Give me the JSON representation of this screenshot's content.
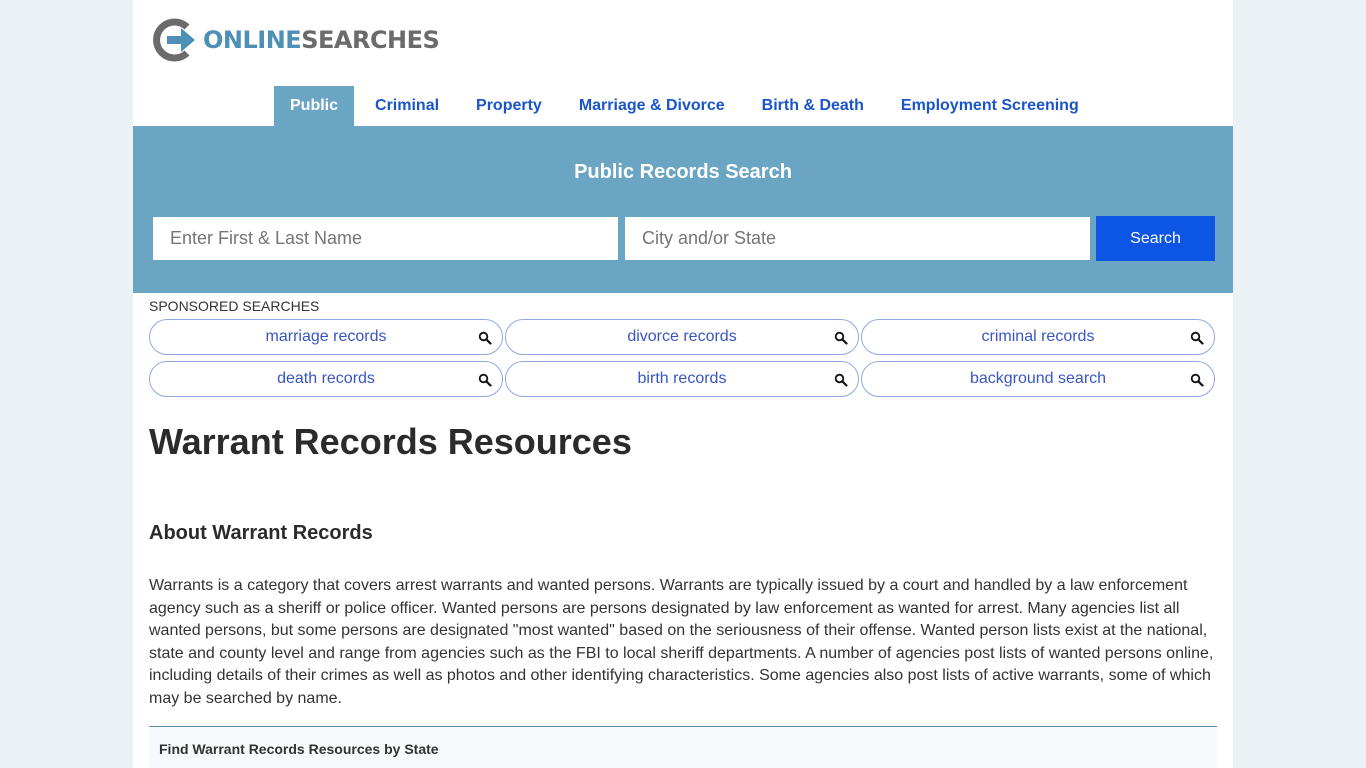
{
  "logo": {
    "part1": "ONLINE",
    "part2": "SEARCHES"
  },
  "nav": {
    "items": [
      {
        "label": "Public",
        "active": true
      },
      {
        "label": "Criminal",
        "active": false
      },
      {
        "label": "Property",
        "active": false
      },
      {
        "label": "Marriage & Divorce",
        "active": false
      },
      {
        "label": "Birth & Death",
        "active": false
      },
      {
        "label": "Employment Screening",
        "active": false
      }
    ]
  },
  "hero": {
    "title": "Public Records Search",
    "name_placeholder": "Enter First & Last Name",
    "name_value": "",
    "location_placeholder": "City and/or State",
    "location_value": "",
    "search_label": "Search"
  },
  "sponsored": {
    "label": "SPONSORED SEARCHES",
    "items": [
      "marriage records",
      "divorce records",
      "criminal records",
      "death records",
      "birth records",
      "background search"
    ]
  },
  "content": {
    "page_title": "Warrant Records Resources",
    "section_title": "About Warrant Records",
    "paragraph": "Warrants is a category that covers arrest warrants and wanted persons. Warrants are typically issued by a court and handled by a law enforcement agency such as a sheriff or police officer. Wanted persons are persons designated by law enforcement as wanted for arrest. Many agencies list all wanted persons, but some persons are designated \"most wanted\" based on the seriousness of their offense. Wanted person lists exist at the national, state and county level and range from agencies such as the FBI to local sheriff departments. A number of agencies post lists of wanted persons online, including details of their crimes as well as photos and other identifying characteristics. Some agencies also post lists of active warrants, some of which may be searched by name.",
    "state_box_title": "Find Warrant Records Resources by State"
  },
  "colors": {
    "page_bg": "#eaf2f6",
    "hero_bg": "#6aa6c3",
    "nav_link": "#1a55c9",
    "search_button": "#0d55e4",
    "pill_text": "#3a55c2",
    "pill_border": "#8fa9e3",
    "logo_blue": "#4d8fb5",
    "logo_gray": "#6b6b6b"
  }
}
